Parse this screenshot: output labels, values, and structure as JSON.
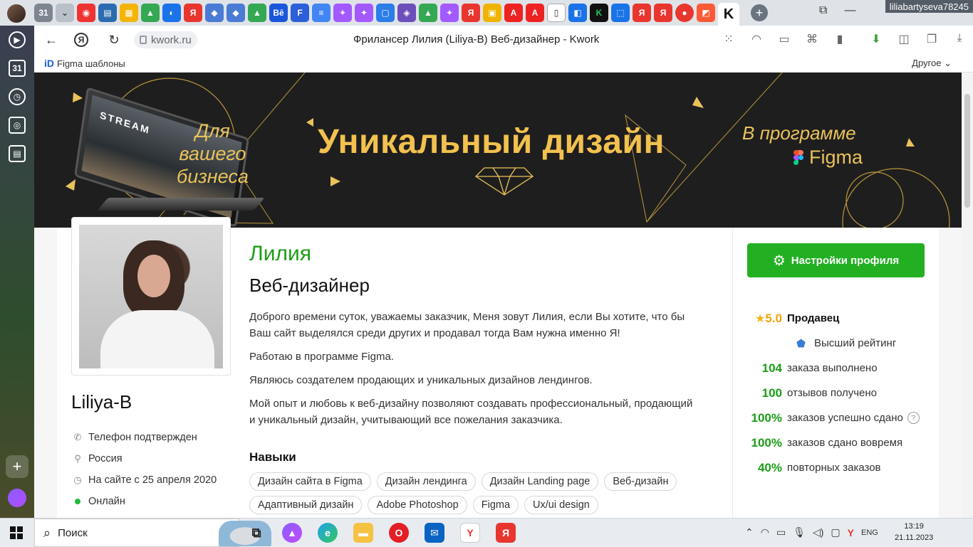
{
  "browser": {
    "account": "liliabartyseva78245",
    "tab_count": "31",
    "url": "kwork.ru",
    "page_title": "Фрилансер Лилия (Liliya-B) Веб-дизайнер - Kwork",
    "bookmark_label": "Figma шаблоны",
    "bookmarks_other": "Другое",
    "rail_calendar": "31"
  },
  "banner": {
    "left_text_line1": "Для",
    "left_text_line2": "вашего",
    "left_text_line3": "бизнеса",
    "main_text": "Уникальный дизайн",
    "right_text": "В программе",
    "right_brand": "Figma",
    "laptop_text": "STREAM"
  },
  "profile": {
    "username": "Liliya-B",
    "info": [
      {
        "icon": "phone-icon",
        "text": "Телефон подтвержден"
      },
      {
        "icon": "location-icon",
        "text": "Россия"
      },
      {
        "icon": "clock-icon",
        "text": "На сайте с 25 апреля 2020"
      },
      {
        "icon": "online-dot",
        "text": "Онлайн"
      }
    ],
    "name": "Лилия",
    "profession": "Веб-дизайнер",
    "about": [
      "Доброго времени суток, уважаемы заказчик, Меня зовут Лилия, если Вы хотите, что бы Ваш сайт выделялся среди других и продавал тогда Вам нужна именно Я!",
      "Работаю в программе Figma.",
      "Являюсь создателем продающих и уникальных дизайнов лендингов.",
      "Мой опыт и любовь к веб-дизайну позволяют создавать профессиональный, продающий и уникальный дизайн, учитывающий все пожелания заказчика."
    ],
    "skills_title": "Навыки",
    "skills": [
      "Дизайн сайта в Figma",
      "Дизайн лендинга",
      "Дизайн Landing page",
      "Веб-дизайн",
      "Адаптивный дизайн",
      "Adobe Photoshop",
      "Figma",
      "Ux/ui design"
    ]
  },
  "sidebar": {
    "settings_button": "Настройки профиля",
    "rating_value": "5.0",
    "rating_label": "Продавец",
    "top_rating": "Высший рейтинг",
    "stats": [
      {
        "value": "104",
        "label": "заказа выполнено"
      },
      {
        "value": "100",
        "label": "отзывов получено"
      },
      {
        "value": "100%",
        "label": "заказов успешно сдано",
        "help": "?"
      },
      {
        "value": "100%",
        "label": "заказов сдано вовремя"
      },
      {
        "value": "40%",
        "label": "повторных заказов"
      }
    ]
  },
  "taskbar": {
    "search_placeholder": "Поиск",
    "lang": "ENG",
    "time": "13:19",
    "date": "21.11.2023"
  },
  "colors": {
    "accent_green": "#22b022",
    "name_green": "#1b9e16",
    "banner_gold": "#f2c14e",
    "star": "#f0b20c"
  }
}
